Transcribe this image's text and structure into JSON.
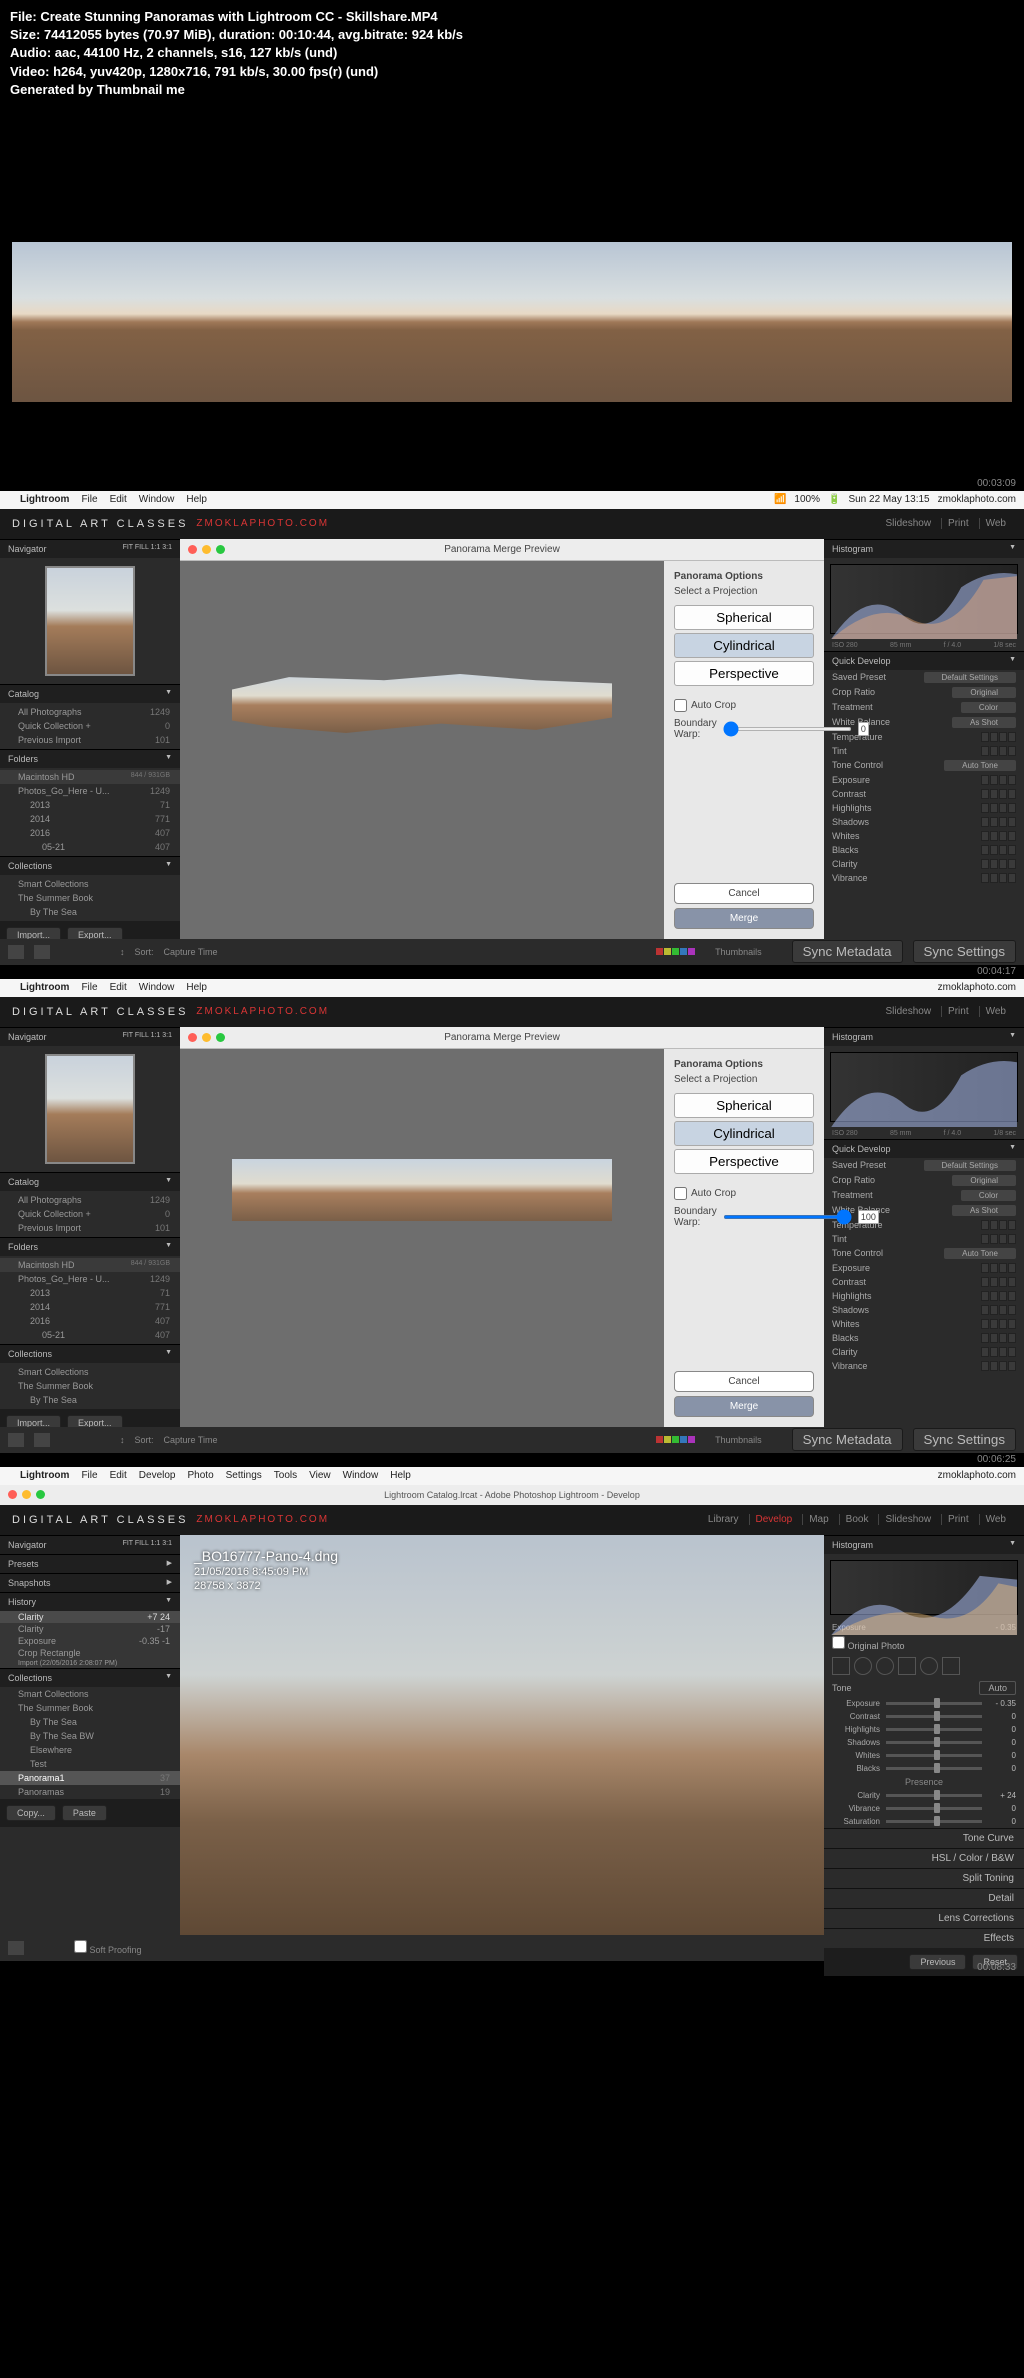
{
  "file_info": {
    "l1": "File: Create Stunning Panoramas with Lightroom CC - Skillshare.MP4",
    "l2": "Size: 74412055 bytes (70.97 MiB), duration: 00:10:44, avg.bitrate: 924 kb/s",
    "l3": "Audio: aac, 44100 Hz, 2 channels, s16, 127 kb/s (und)",
    "l4": "Video: h264, yuv420p, 1280x716, 791 kb/s, 30.00 fps(r) (und)",
    "l5": "Generated by Thumbnail me"
  },
  "timestamps": {
    "f1": "00:03:09",
    "f2": "00:04:17",
    "f3": "00:06:25",
    "f4": "00:08:33"
  },
  "mac_menu": {
    "apple": "",
    "app": "Lightroom",
    "file": "File",
    "edit": "Edit",
    "window": "Window",
    "help": "Help",
    "develop": "Develop",
    "photo": "Photo",
    "settings": "Settings",
    "tools": "Tools",
    "view": "View",
    "wifi": "100%",
    "date": "Sun 22 May 13:15",
    "site": "zmoklaphoto.com"
  },
  "lr": {
    "brand": "DIGITAL ART CLASSES",
    "brand2": "ZMOKLAPHOTO.COM",
    "titlebar_catalog": "Lightroom Catalog.lrcat - Adobe Photoshop Lightroom - Develop",
    "modules": {
      "library": "Library",
      "develop": "Develop",
      "map": "Map",
      "book": "Book",
      "slideshow": "Slideshow",
      "print": "Print",
      "web": "Web"
    }
  },
  "dialog": {
    "title": "Panorama Merge Preview",
    "opt_title": "Panorama Options",
    "opt_sub": "Select a Projection",
    "spherical": "Spherical",
    "cylindrical": "Cylindrical",
    "perspective": "Perspective",
    "autocrop": "Auto Crop",
    "bwarp": "Boundary Warp:",
    "bwarp_v1": "0",
    "bwarp_v2": "100",
    "cancel": "Cancel",
    "merge": "Merge"
  },
  "left": {
    "navigator": "Navigator",
    "nav_modes": "FIT  FILL  1:1  3:1",
    "catalog": "Catalog",
    "cat_all": "All Photographs",
    "cat_all_n": "1249",
    "cat_quick": "Quick Collection +",
    "cat_quick_n": "0",
    "cat_prev": "Previous Import",
    "cat_prev_n": "101",
    "folders": "Folders",
    "hd": "Macintosh HD",
    "hd_n": "844 / 931GB",
    "f_photos": "Photos_Go_Here - U...",
    "f_photos_n": "1249",
    "f_2013": "2013",
    "f_2013_n": "71",
    "f_2014": "2014",
    "f_2014_n": "771",
    "f_2016": "2016",
    "f_2016_n": "407",
    "f_0521": "05-21",
    "f_0521_n": "407",
    "collections": "Collections",
    "c_smart": "Smart Collections",
    "c_summer": "The Summer Book",
    "c_sea": "By The Sea",
    "import": "Import...",
    "export": "Export..."
  },
  "right": {
    "histogram": "Histogram",
    "iso": "ISO 280",
    "mm": "85 mm",
    "f": "f / 4.0",
    "s": "1/8 sec",
    "qd": "Quick Develop",
    "preset": "Saved Preset",
    "preset_v": "Default Settings",
    "ratio": "Crop Ratio",
    "ratio_v": "Original",
    "treat": "Treatment",
    "treat_v": "Color",
    "wb": "White Balance",
    "wb_v": "As Shot",
    "temp": "Temperature",
    "tint": "Tint",
    "tone": "Tone Control",
    "auto": "Auto Tone",
    "expo": "Exposure",
    "contrast": "Contrast",
    "highlights": "Highlights",
    "shadows": "Shadows",
    "whites": "Whites",
    "blacks": "Blacks",
    "clarity": "Clarity",
    "vibrance": "Vibrance",
    "sync_meta": "Sync Metadata",
    "sync_set": "Sync Settings"
  },
  "toolbar": {
    "sort": "Sort:",
    "sort_v": "Capture Time",
    "thumbs": "Thumbnails"
  },
  "dev": {
    "filename": "_BO16777-Pano-4.dng",
    "datetime": "21/05/2016 8:45:09 PM",
    "dimensions": "28758 x 3872",
    "presets": "Presets",
    "snapshots": "Snapshots",
    "history": "History",
    "h_clarity": "Clarity",
    "h_clarity_v": "+7   24",
    "h_clarity2": "Clarity",
    "h_clarity2_v": "-17",
    "h_expo": "Exposure",
    "h_expo_v": "-0.35  -1",
    "h_crop": "Crop Rectangle",
    "h_import": "Import (22/05/2016 2:08:07 PM)",
    "c_sea": "By The Sea",
    "c_sea_bw": "By The Sea BW",
    "c_else": "Elsewhere",
    "c_test": "Test",
    "c_pano1": "Panorama1",
    "c_pano1_n": "37",
    "c_panos": "Panoramas",
    "c_panos_n": "19",
    "copy": "Copy...",
    "paste": "Paste",
    "soft": "Soft Proofing",
    "expo_v": "- 0.35",
    "basic_auto": "Auto",
    "tone": "Tone",
    "presence": "Presence",
    "clarity_v": "+ 24",
    "vib_v": "0",
    "sat_v": "0",
    "tonecurve": "Tone Curve",
    "hsl": "HSL / Color / B&W",
    "split": "Split Toning",
    "detail": "Detail",
    "lens": "Lens Corrections",
    "effects": "Effects",
    "prev": "Previous",
    "reset": "Reset",
    "orig": "Original Photo",
    "expo_lbl": "Exposure",
    "expo_ev": "- 0.35"
  }
}
